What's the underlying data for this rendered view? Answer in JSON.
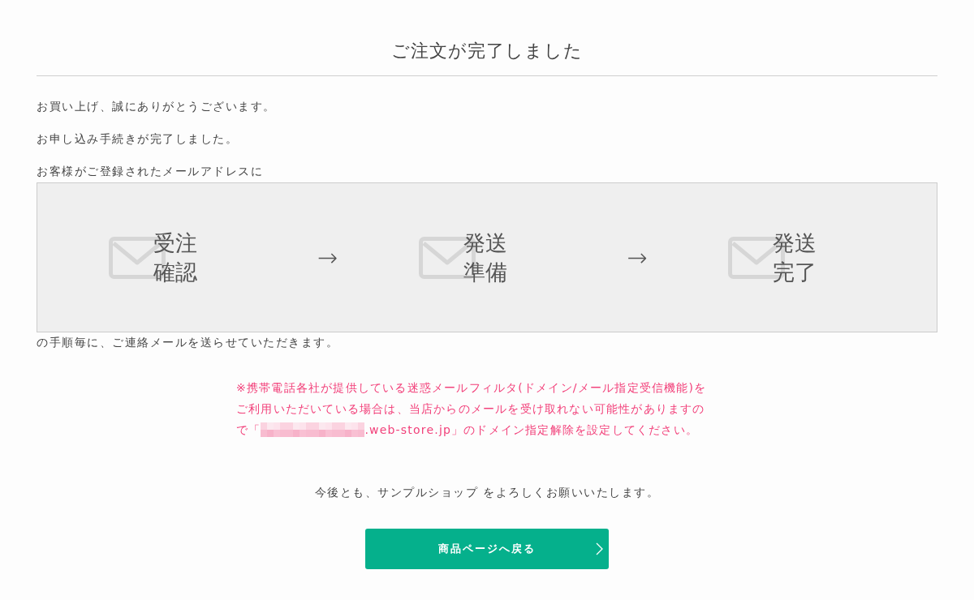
{
  "title": "ご注文が完了しました",
  "intro_lines": [
    "お買い上げ、誠にありがとうございます。",
    "お申し込み手続きが完了しました。",
    "お客様がご登録されたメールアドレスに"
  ],
  "steps": [
    {
      "label": "受注確認"
    },
    {
      "label": "発送準備"
    },
    {
      "label": "発送完了"
    }
  ],
  "step_separator": "→",
  "after_steps": "の手順毎に、ご連絡メールを送らせていただきます。",
  "notice": {
    "lines": [
      "※携帯電話各社が提供している迷惑メールフィルタ(ドメイン/メール指定受信機能)を",
      "ご利用いただいている場合は、当店からのメールを受け取れない可能性がありますの"
    ],
    "last_line_before_redaction": "で「",
    "last_line_after_redaction": ".web-store.jp」のドメイン指定解除を設定してください。"
  },
  "closing": "今後とも、サンプルショップ をよろしくお願いいたします。",
  "back_button": {
    "label": "商品ページへ戻る"
  }
}
